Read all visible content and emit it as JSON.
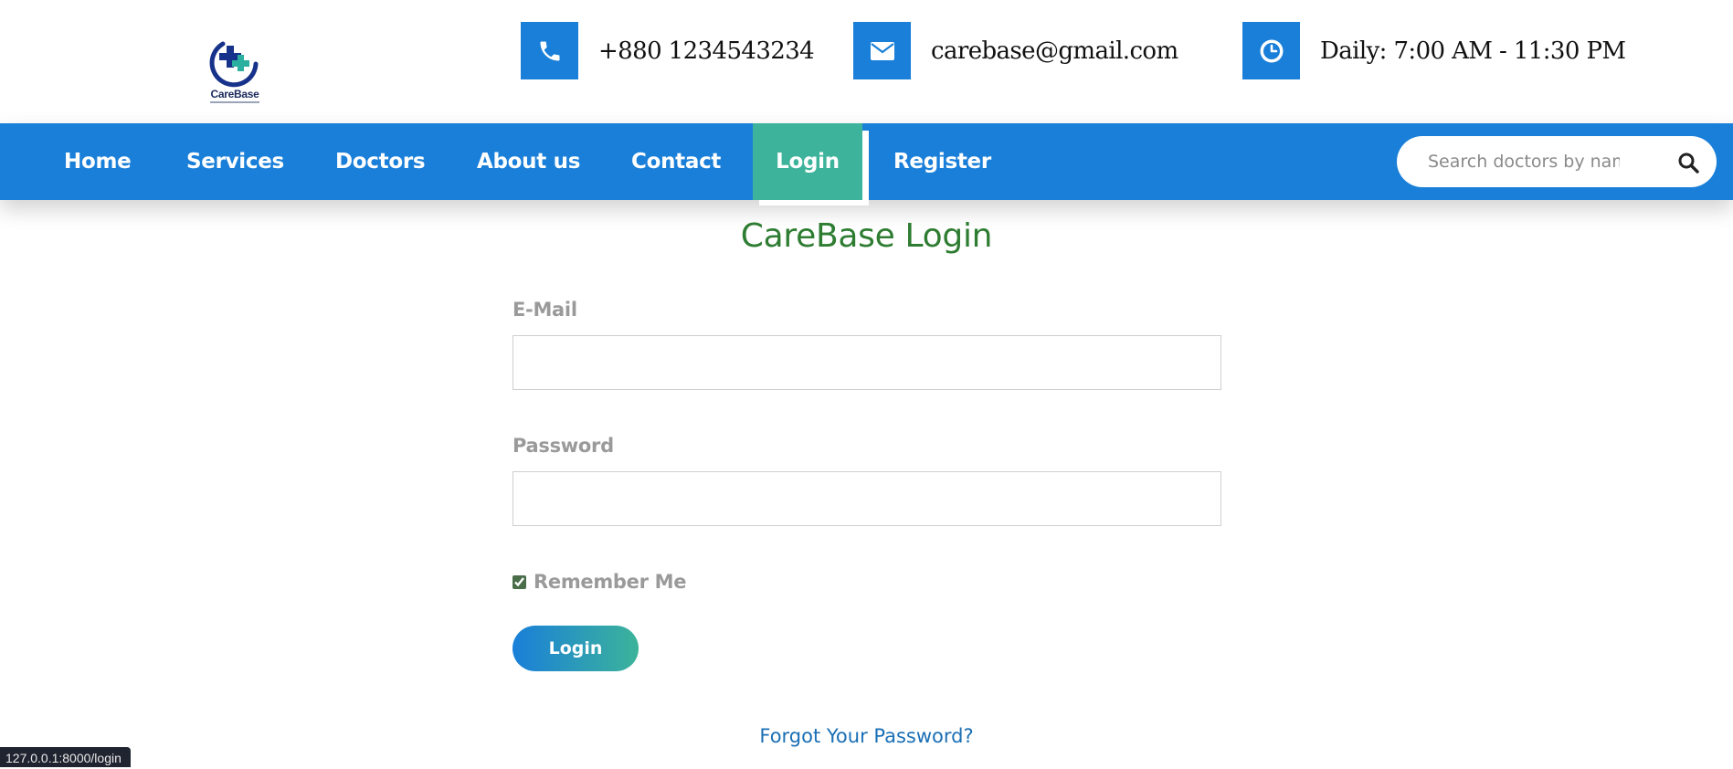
{
  "brand": {
    "logo_text": "CareBase"
  },
  "contacts": {
    "phone": {
      "icon": "phone-icon",
      "text": "+880 1234543234"
    },
    "email": {
      "icon": "envelope-icon",
      "text": "carebase@gmail.com"
    },
    "hours": {
      "icon": "clock-icon",
      "text": "Daily: 7:00 AM - 11:30 PM"
    }
  },
  "nav": {
    "items": [
      {
        "label": "Home"
      },
      {
        "label": "Services"
      },
      {
        "label": "Doctors"
      },
      {
        "label": "About us"
      },
      {
        "label": "Contact"
      },
      {
        "label": "Login",
        "active": true
      },
      {
        "label": "Register"
      }
    ],
    "search_placeholder": "Search doctors by name"
  },
  "login_form": {
    "title": "CareBase Login",
    "email_label": "E-Mail",
    "email_value": "",
    "password_label": "Password",
    "password_value": "",
    "remember_label": "Remember Me",
    "remember_checked": true,
    "submit_label": "Login",
    "forgot_label": "Forgot Your Password?"
  },
  "status_url": "127.0.0.1:8000/login",
  "colors": {
    "primary": "#1a7fd9",
    "accent": "#3cb39a",
    "title": "#2e7d32",
    "link": "#1a6fb5"
  }
}
